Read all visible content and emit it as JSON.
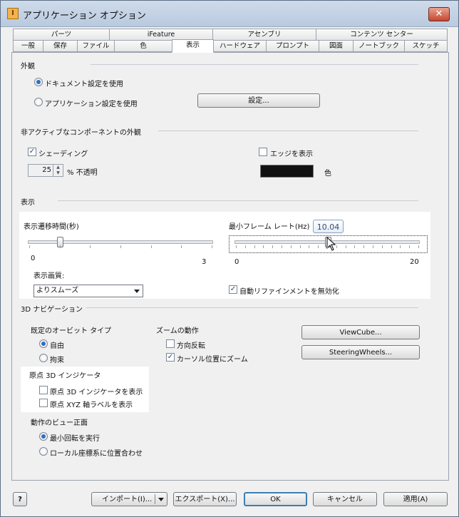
{
  "window": {
    "title": "アプリケーション オプション",
    "close": "✕",
    "icon_letter": "I"
  },
  "tabs_row1": [
    "パーツ",
    "iFeature",
    "アセンブリ",
    "コンテンツ センター"
  ],
  "tabs_row2": [
    "一般",
    "保存",
    "ファイル",
    "色",
    "表示",
    "ハードウェア",
    "プロンプト",
    "図面",
    "ノートブック",
    "スケッチ"
  ],
  "appearance": {
    "title": "外観",
    "use_document": "ドキュメント設定を使用",
    "use_application": "アプリケーション設定を使用",
    "settings_button": "設定..."
  },
  "inactive": {
    "title": "非アクティブなコンポーネントの外観",
    "shading": "シェーディング",
    "show_edges": "エッジを表示",
    "opacity_value": "25",
    "opacity_label": "% 不透明",
    "color_label": "色",
    "edge_color": "#111111"
  },
  "display": {
    "title": "表示",
    "transition_label": "表示遷移時間(秒)",
    "transition_value": 0.5,
    "transition_min": "0",
    "transition_max": "3",
    "framerate_label": "最小フレーム レート(Hz)",
    "framerate_tooltip": "10.04",
    "framerate_value": 10.04,
    "framerate_min": "0",
    "framerate_max": "20",
    "quality_label": "表示画質:",
    "quality_value": "よりスムーズ",
    "disable_auto_refine": "自動リファインメントを無効化"
  },
  "nav3d": {
    "title": "3D ナビゲーション",
    "orbit_title": "既定のオービット タイプ",
    "orbit_free": "自由",
    "orbit_constrained": "拘束",
    "zoom_title": "ズームの動作",
    "zoom_reverse": "方向反転",
    "zoom_cursor": "カーソル位置にズーム",
    "viewcube_button": "ViewCube...",
    "steering_button": "SteeringWheels...",
    "origin_title": "原点 3D インジケータ",
    "origin_show": "原点 3D インジケータを表示",
    "origin_xyz": "原点 XYZ 軸ラベルを表示",
    "front_title": "動作のビュー正面",
    "minimum_rotation": "最小回転を実行",
    "align_local": "ローカル座標系に位置合わせ"
  },
  "footer": {
    "help": "?",
    "import": "インポート(I)...",
    "export": "エクスポート(X)...",
    "ok": "OK",
    "cancel": "キャンセル",
    "apply": "適用(A)"
  }
}
